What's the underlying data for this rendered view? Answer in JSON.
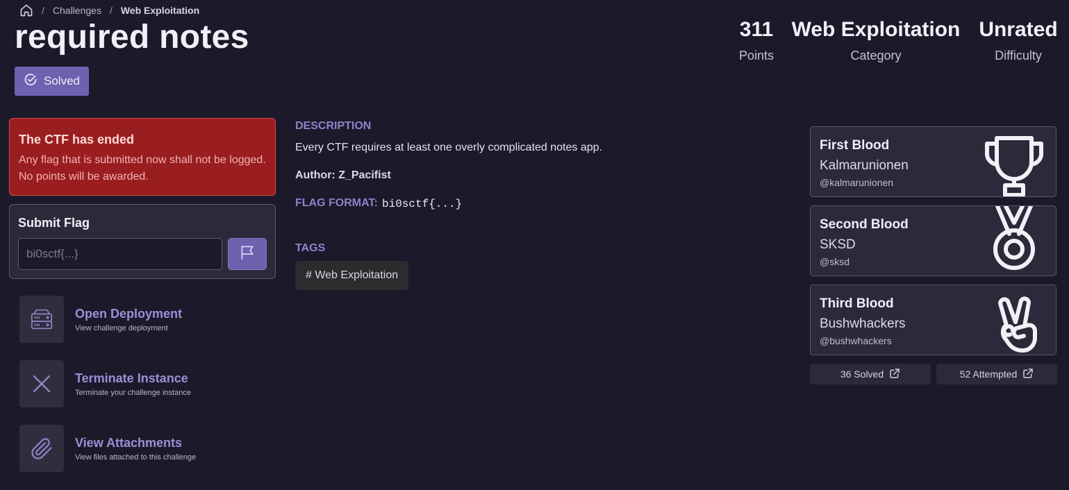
{
  "breadcrumb": {
    "home_icon": "home-icon",
    "items": [
      "Challenges",
      "Web Exploitation"
    ]
  },
  "challenge": {
    "title": "required notes",
    "status": "Solved",
    "points": "311",
    "points_label": "Points",
    "category": "Web Exploitation",
    "category_label": "Category",
    "difficulty": "Unrated",
    "difficulty_label": "Difficulty"
  },
  "alert": {
    "title": "The CTF has ended",
    "message": "Any flag that is submitted now shall not be logged. No points will be awarded."
  },
  "submit_flag": {
    "title": "Submit Flag",
    "placeholder": "bi0sctf{...}",
    "value": "",
    "button_icon": "flag-icon"
  },
  "actions": [
    {
      "title": "Open Deployment",
      "subtitle": "View challenge deployment",
      "icon": "server-icon"
    },
    {
      "title": "Terminate Instance",
      "subtitle": "Terminate your challenge instance",
      "icon": "close-icon"
    },
    {
      "title": "View Attachments",
      "subtitle": "View files attached to this challenge",
      "icon": "paperclip-icon"
    }
  ],
  "description": {
    "label": "DESCRIPTION",
    "text": "Every CTF requires at least one overly complicated notes app.",
    "author": "Author: Z_Pacifist",
    "flag_format_label": "FLAG FORMAT:",
    "flag_format": "bi0sctf{...}"
  },
  "tags": {
    "label": "TAGS",
    "items": [
      "# Web Exploitation"
    ]
  },
  "bloods": [
    {
      "title": "First Blood",
      "team": "Kalmarunionen",
      "handle": "@kalmarunionen",
      "icon": "trophy-icon"
    },
    {
      "title": "Second Blood",
      "team": "SKSD",
      "handle": "@sksd",
      "icon": "medal-icon"
    },
    {
      "title": "Third Blood",
      "team": "Bushwhackers",
      "handle": "@bushwhackers",
      "icon": "victory-hand-icon"
    }
  ],
  "stats": {
    "solved": "36 Solved",
    "attempted": "52 Attempted"
  },
  "colors": {
    "background": "#1c1a2a",
    "accent": "#6e61b0",
    "alert": "#9a1d1f",
    "card": "#2b2a3a"
  }
}
